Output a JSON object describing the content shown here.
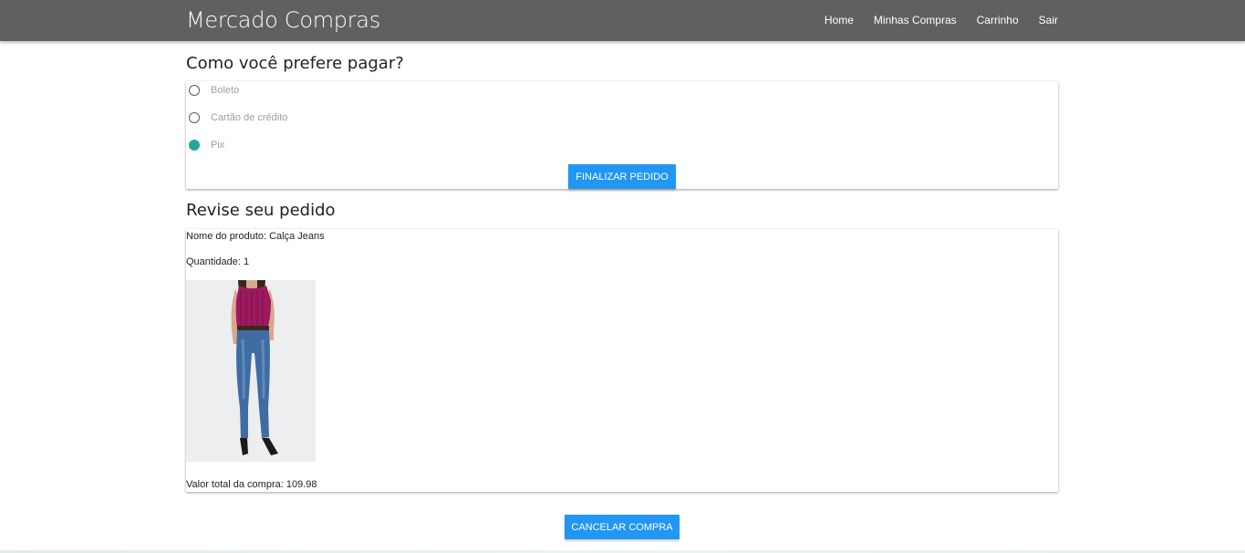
{
  "navbar": {
    "brand": "Mercado Compras",
    "links": [
      "Home",
      "Minhas Compras",
      "Carrinho",
      "Sair"
    ]
  },
  "payment": {
    "title": "Como você prefere pagar?",
    "options": [
      {
        "label": "Boleto",
        "checked": false
      },
      {
        "label": "Cartão de crédito",
        "checked": false
      },
      {
        "label": "Pix",
        "checked": true
      }
    ],
    "finalize_label": "Finalizar pedido"
  },
  "review": {
    "title": "Revise seu pedido",
    "product_name": "Nome do produto: Calça Jeans",
    "quantity": "Quantidade: 1",
    "total": "Valor total da compra: 109.98"
  },
  "cancel_label": "Cancelar compra",
  "colors": {
    "navbar": "#606060",
    "button": "#2196f3",
    "radio_checked": "#26a69a"
  }
}
